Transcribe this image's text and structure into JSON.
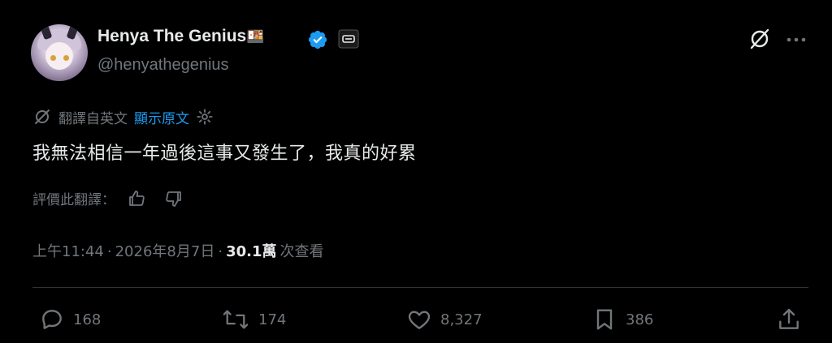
{
  "author": {
    "display_name": "Henya The Genius",
    "name_emoji": "🍱",
    "handle": "@henyathegenius"
  },
  "translation": {
    "label": "翻譯自英文",
    "show_original": "顯示原文"
  },
  "tweet": {
    "text": "我無法相信一年過後這事又發生了，我真的好累"
  },
  "rating": {
    "label": "評價此翻譯："
  },
  "meta": {
    "time": "上午11:44",
    "separator1": "·",
    "date": "2026年8月7日",
    "separator2": "·",
    "views_count": "30.1萬",
    "views_label": "次查看"
  },
  "actions": {
    "replies": "168",
    "reposts": "174",
    "likes": "8,327",
    "bookmarks": "386"
  },
  "colors": {
    "background": "#000000",
    "text": "#e7e9ea",
    "muted": "#71767b",
    "accent": "#1d9bf0",
    "divider": "#2f3336"
  }
}
